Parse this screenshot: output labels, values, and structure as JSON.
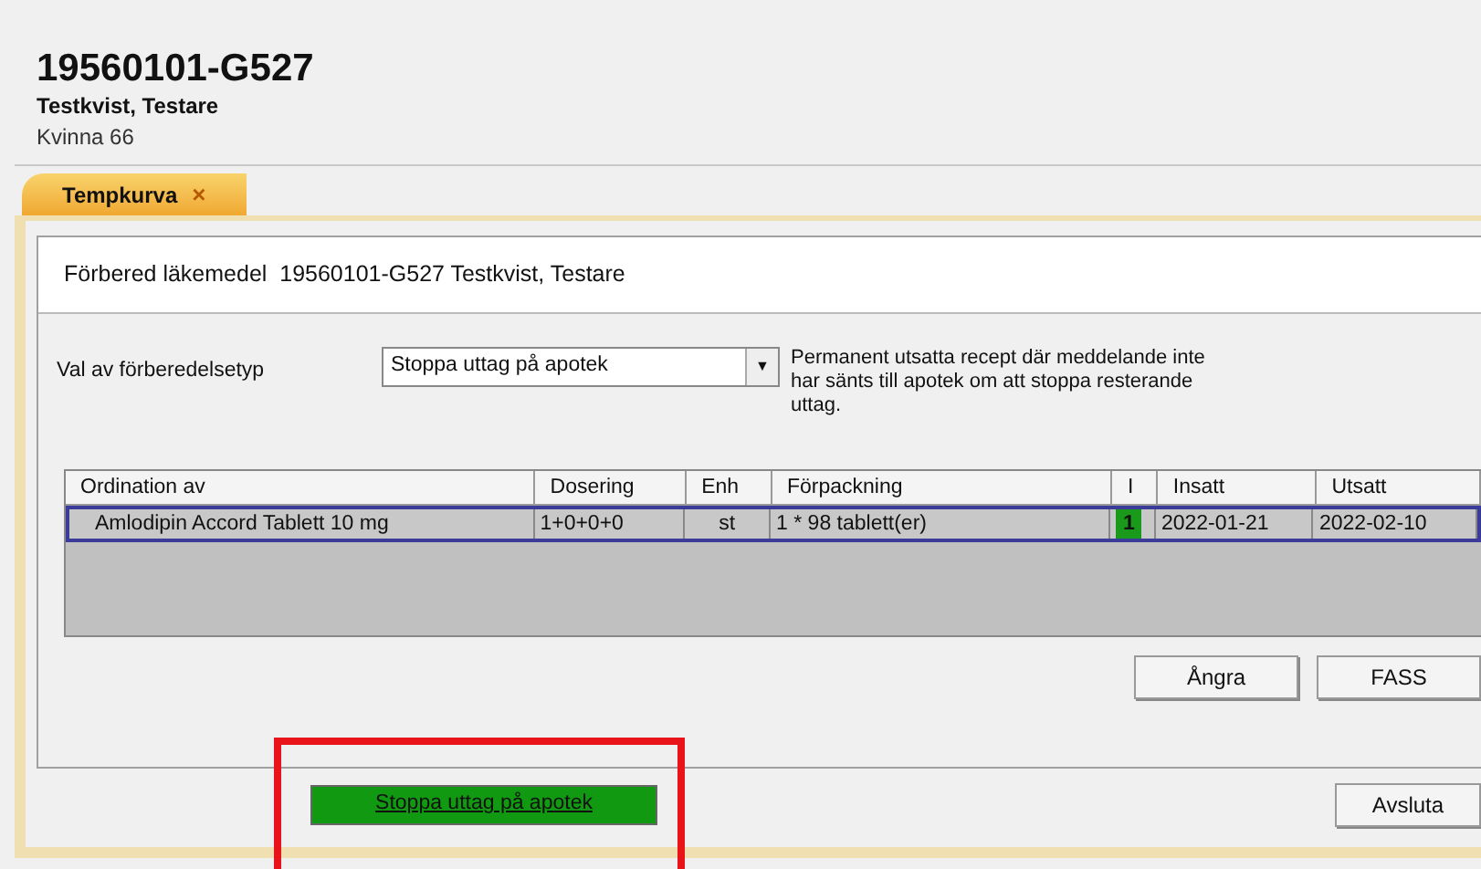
{
  "patient": {
    "id": "19560101-G527",
    "name": "Testkvist, Testare",
    "info": "Kvinna 66"
  },
  "tabs": [
    {
      "label": "Tempkurva",
      "close": "×",
      "selected": true
    }
  ],
  "dialog": {
    "title": "Förbered läkemedel  19560101-G527 Testkvist, Testare",
    "type_label": "Val av förberedelsetyp",
    "type_value": "Stoppa uttag på apotek",
    "type_arrow": "▼",
    "description": "Permanent utsatta recept där meddelande inte har sänts till apotek om att stoppa resterande uttag.",
    "table": {
      "columns": [
        "Ordination av",
        "Dosering",
        "Enh",
        "Förpackning",
        "I",
        "Insatt",
        "Utsatt"
      ],
      "rows": [
        {
          "selected": true,
          "cells": [
            "Amlodipin Accord Tablett 10 mg",
            "1+0+0+0",
            "st",
            "1 * 98 tablett(er)",
            "1",
            "2022-01-21",
            "2022-02-10"
          ]
        }
      ]
    },
    "buttons": [
      "Ångra",
      "FASS"
    ]
  },
  "action_button": "Stoppa uttag på apotek",
  "close_button": "Avsluta",
  "highlight": true
}
